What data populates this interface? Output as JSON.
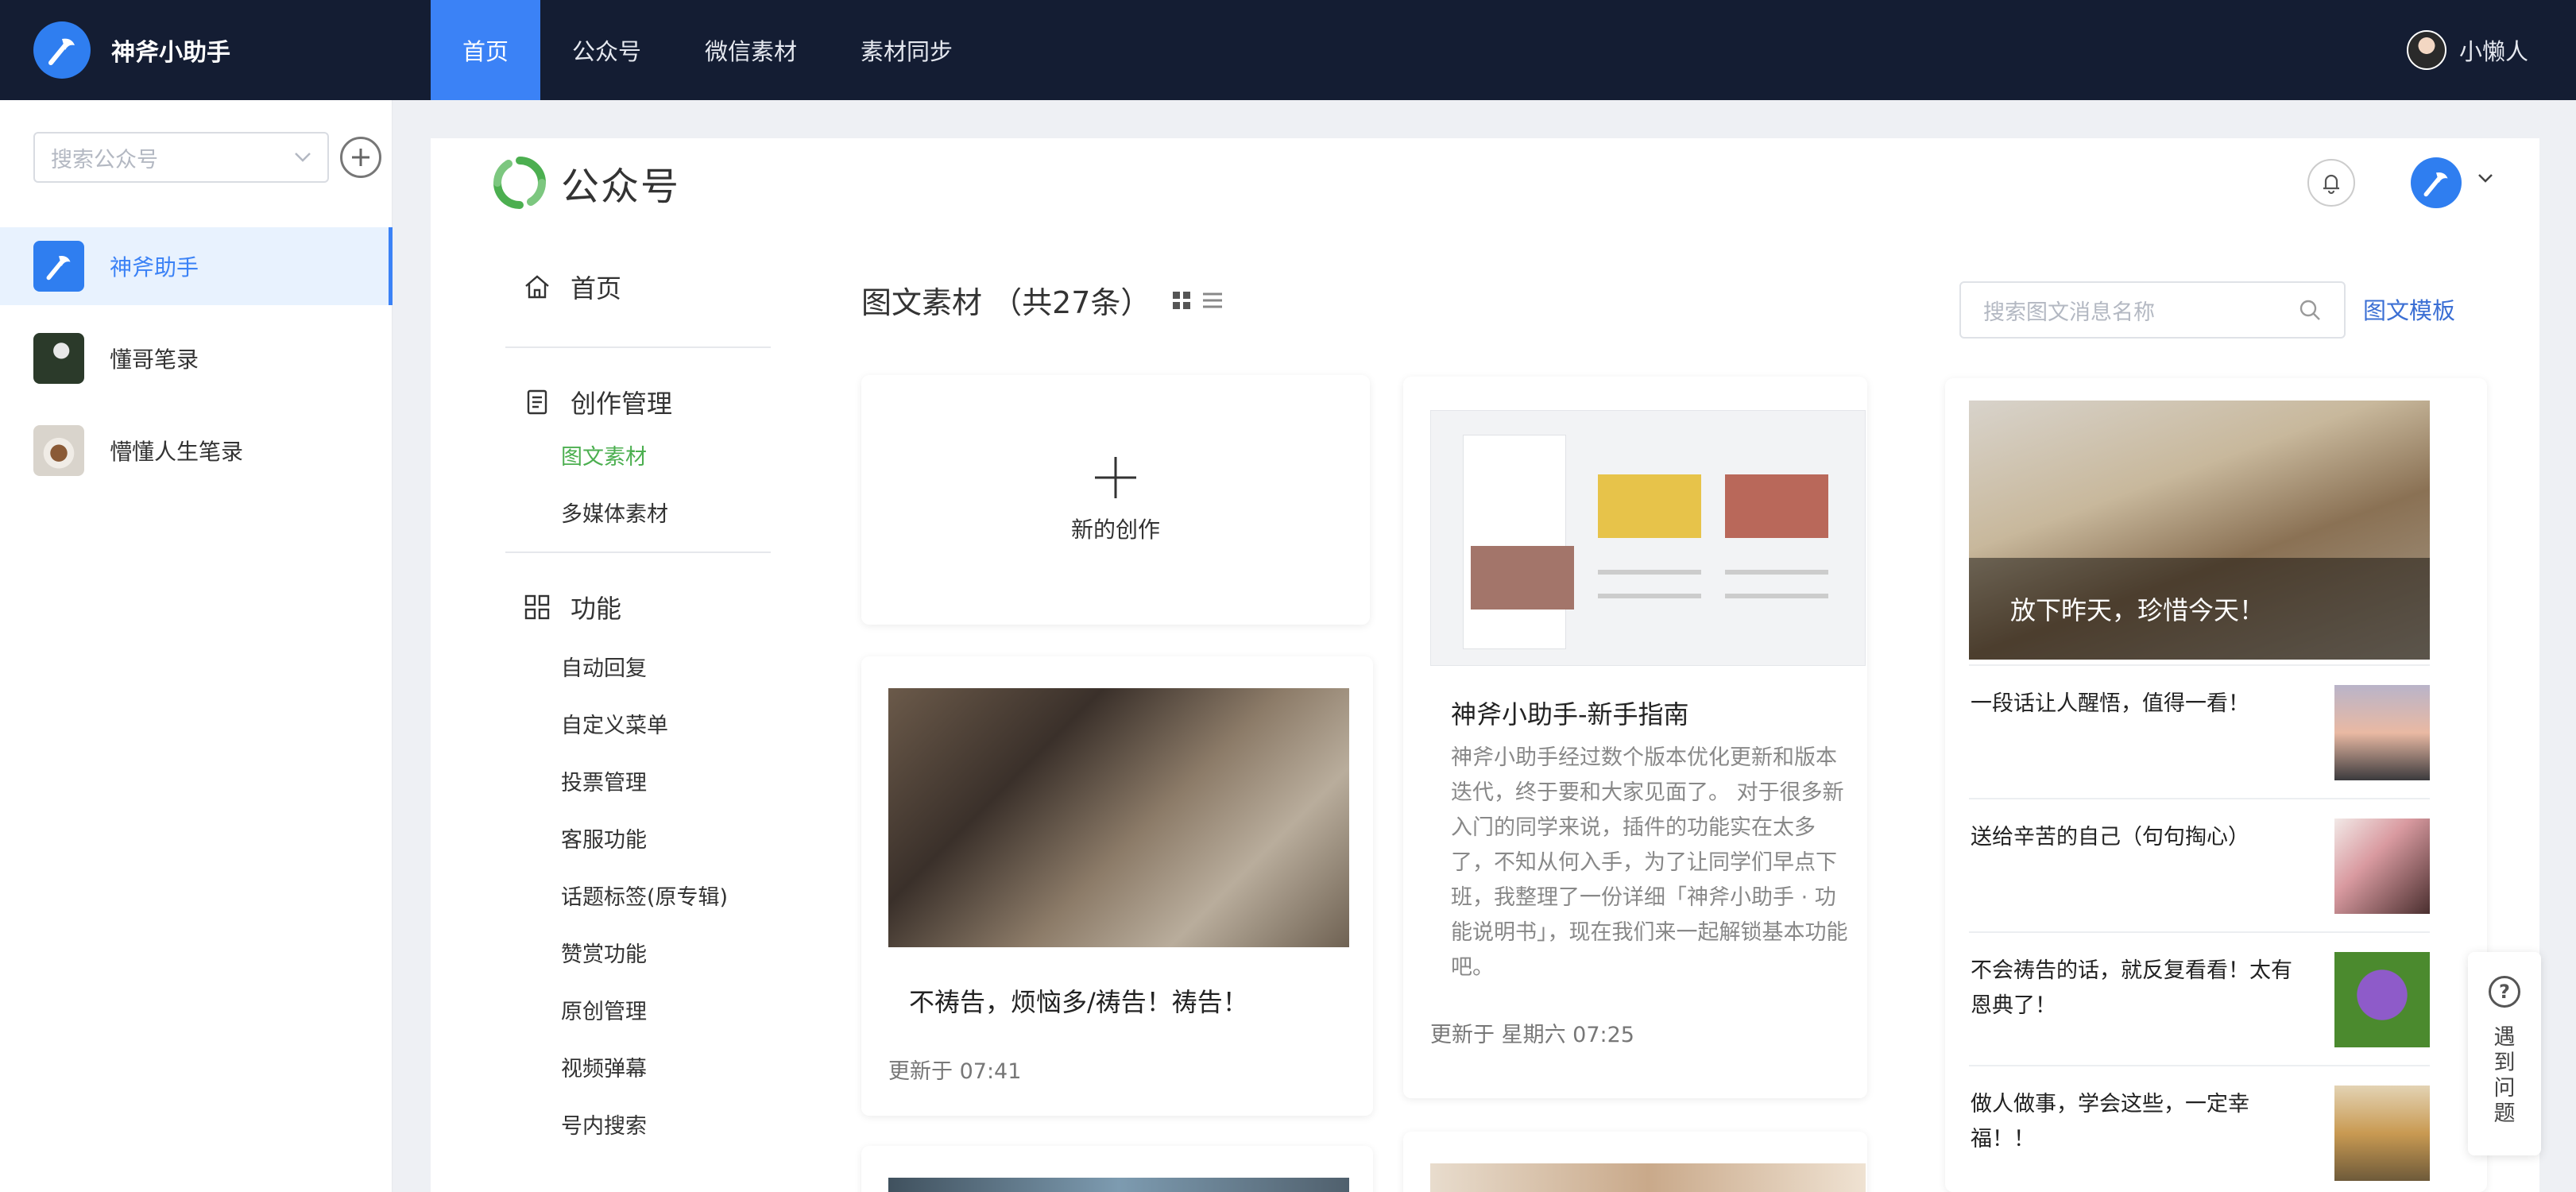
{
  "app": {
    "brand_name": "神斧小助手"
  },
  "nav": {
    "items": [
      {
        "label": "首页",
        "active": true
      },
      {
        "label": "公众号",
        "active": false
      },
      {
        "label": "微信素材",
        "active": false
      },
      {
        "label": "素材同步",
        "active": false
      }
    ]
  },
  "user": {
    "name": "小懒人"
  },
  "sidebar": {
    "search_placeholder": "搜索公众号",
    "accounts": [
      {
        "name": "神斧助手",
        "active": true
      },
      {
        "name": "懂哥笔录",
        "active": false
      },
      {
        "name": "懵懂人生笔录",
        "active": false
      }
    ]
  },
  "main": {
    "title": "公众号"
  },
  "menu": {
    "home": "首页",
    "group1": "创作管理",
    "group1_items": [
      "图文素材",
      "多媒体素材"
    ],
    "group2": "功能",
    "group2_items": [
      "自动回复",
      "自定义菜单",
      "投票管理",
      "客服功能",
      "话题标签(原专辑)",
      "赞赏功能",
      "原创管理",
      "视频弹幕",
      "号内搜索"
    ]
  },
  "list": {
    "title": "图文素材 （共27条）",
    "search_placeholder": "搜索图文消息名称",
    "template_link": "图文模板",
    "new_label": "新的创作"
  },
  "cards": {
    "c1": {
      "title": "不祷告，烦恼多/祷告！祷告！",
      "updated": "更新于 07:41"
    },
    "c2": {
      "title": "神斧小助手-新手指南",
      "summary": "神斧小助手经过数个版本优化更新和版本迭代，终于要和大家见面了。 对于很多新入门的同学来说，插件的功能实在太多了，不知从何入手，为了让同学们早点下班，我整理了一份详细「神斧小助手 · 功能说明书」，现在我们来一起解锁基本功能吧。",
      "updated": "更新于 星期六 07:25"
    },
    "c3": {
      "hero_caption": "放下昨天，珍惜今天！",
      "items": [
        {
          "title": "一段话让人醒悟，值得一看！"
        },
        {
          "title": "送给辛苦的自己（句句掏心）"
        },
        {
          "title": "不会祷告的话，就反复看看！太有恩典了！"
        },
        {
          "title": "做人做事，学会这些，一定幸福！！"
        }
      ]
    }
  },
  "help": {
    "text": "遇到问题"
  },
  "colors": {
    "accent": "#3b82f6",
    "active_green": "#4caf50",
    "topbar": "#141d33",
    "link": "#3b6fd4"
  }
}
